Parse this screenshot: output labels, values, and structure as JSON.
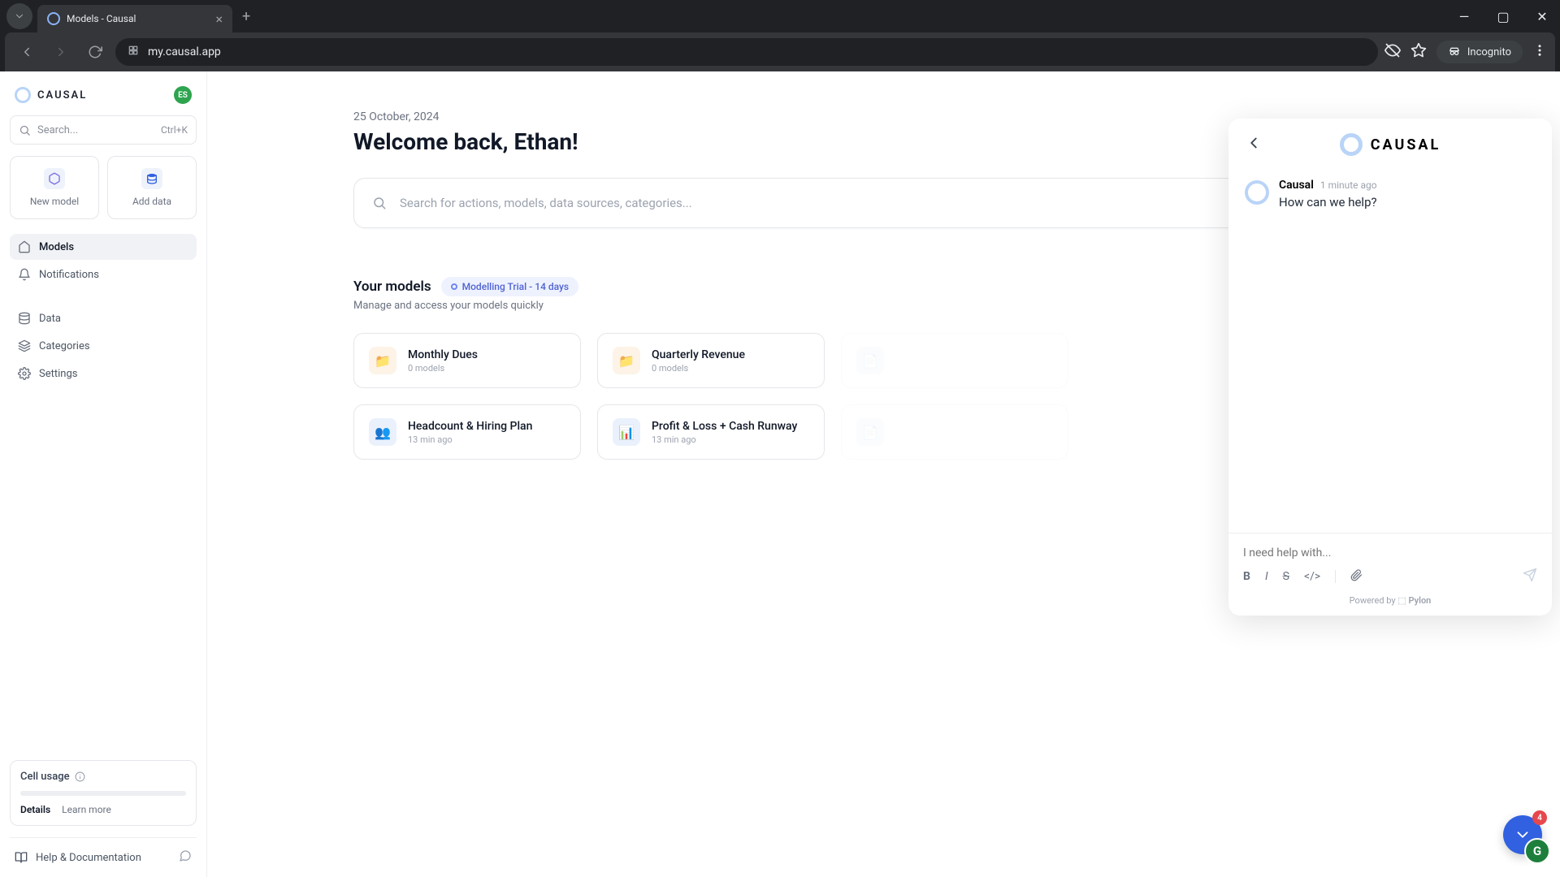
{
  "browser": {
    "tab_title": "Models - Causal",
    "url": "my.causal.app",
    "incognito_label": "Incognito"
  },
  "sidebar": {
    "brand": "CAUSAL",
    "avatar_initials": "ES",
    "search_placeholder": "Search...",
    "search_shortcut": "Ctrl+K",
    "actions": {
      "new_model": "New model",
      "add_data": "Add data"
    },
    "nav": {
      "models": "Models",
      "notifications": "Notifications",
      "data": "Data",
      "categories": "Categories",
      "settings": "Settings"
    },
    "cell_usage": {
      "title": "Cell usage",
      "details": "Details",
      "learn_more": "Learn more"
    },
    "help_label": "Help & Documentation"
  },
  "main": {
    "date": "25 October, 2024",
    "welcome": "Welcome back, Ethan!",
    "big_search_placeholder": "Search for actions, models, data sources, categories...",
    "models_section": {
      "title": "Your models",
      "trial_badge": "Modelling Trial - 14 days",
      "subtitle": "Manage and access your models quickly"
    },
    "models": [
      {
        "name": "Monthly Dues",
        "meta": "0 models",
        "icon": "folder"
      },
      {
        "name": "Quarterly Revenue",
        "meta": "0 models",
        "icon": "folder"
      },
      {
        "name": "",
        "meta": "",
        "icon": "doc"
      },
      {
        "name": "Headcount & Hiring Plan",
        "meta": "13 min ago",
        "icon": "people"
      },
      {
        "name": "Profit & Loss + Cash Runway",
        "meta": "13 min ago",
        "icon": "doc"
      },
      {
        "name": "",
        "meta": "",
        "icon": "doc"
      }
    ]
  },
  "chat": {
    "brand": "CAUSAL",
    "sender": "Causal",
    "timestamp": "1 minute ago",
    "message": "How can we help?",
    "input_placeholder": "I need help with...",
    "powered_by": "Powered by",
    "provider": "Pylon",
    "badge_count": "4"
  },
  "colors": {
    "accent": "#3161e0",
    "success": "#2ea44f",
    "danger": "#e5484d"
  }
}
